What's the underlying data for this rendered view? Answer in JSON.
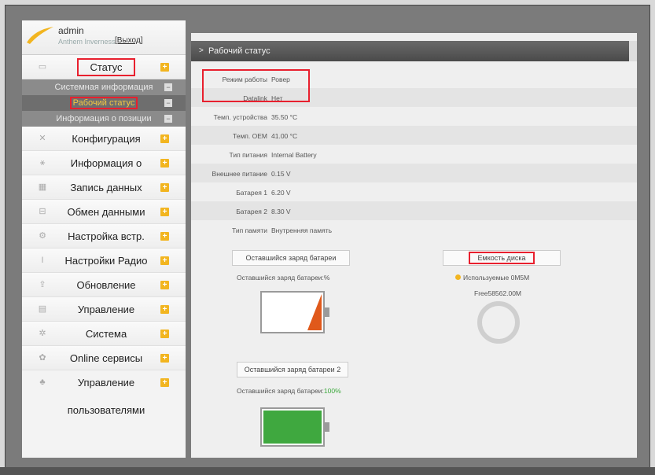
{
  "user": {
    "name": "admin",
    "subtitle": "Anthem Inverness",
    "logout": "[Выход]"
  },
  "sidebar": {
    "items": [
      {
        "label": "Статус",
        "icon": "monitor-icon"
      },
      {
        "label": "Конфигурация",
        "icon": "tools-icon"
      },
      {
        "label": "Информация о",
        "icon": "satellite-icon"
      },
      {
        "label": "Запись данных",
        "icon": "calendar-icon"
      },
      {
        "label": "Обмен данными",
        "icon": "network-icon"
      },
      {
        "label": "Настройка встр.",
        "icon": "settings-icon"
      },
      {
        "label": "Настройки Радио",
        "icon": "antenna-icon"
      },
      {
        "label": "Обновление",
        "icon": "upload-icon"
      },
      {
        "label": "Управление",
        "icon": "chip-icon"
      },
      {
        "label": "Система",
        "icon": "gear-icon"
      },
      {
        "label": "Online сервисы",
        "icon": "cloud-icon"
      },
      {
        "label": "Управление",
        "label2": "пользователями",
        "icon": "users-icon"
      }
    ],
    "submenu": [
      {
        "label": "Системная информация"
      },
      {
        "label": "Рабочий статус"
      },
      {
        "label": "Информация о позиции"
      }
    ]
  },
  "main": {
    "header": "Рабочий статус",
    "rows": [
      {
        "label": "Режим работы",
        "value": "Ровер"
      },
      {
        "label": "Datalink",
        "value": "Нет"
      },
      {
        "label": "Темп. устройства",
        "value": "35.50 °C"
      },
      {
        "label": "Темп. OEM",
        "value": "41.00 °C"
      },
      {
        "label": "Тип питания",
        "value": "Internal Battery"
      },
      {
        "label": "Внешнее питание",
        "value": "0.15 V"
      },
      {
        "label": "Батарея 1",
        "value": "6.20 V"
      },
      {
        "label": "Батарея 2",
        "value": "8.30 V"
      },
      {
        "label": "Тип памяти",
        "value": "Внутренняя память"
      }
    ],
    "battery1": {
      "title": "Оставшийся заряд батареи",
      "text": "Оставшийся заряд батареи:%",
      "level": 0.05
    },
    "battery2": {
      "title": "Оставшийся заряд батареи 2",
      "text_prefix": "Оставшийся заряд батареи:",
      "text_value": "100%",
      "level": 1.0
    },
    "disk": {
      "title": "Емкость диска",
      "used": "Используемые 0M5M",
      "free": "Free58562.00M"
    }
  },
  "colors": {
    "accent": "#f2b520",
    "highlight": "#e8202e",
    "battery_low": "#e0591b",
    "battery_full": "#3fa83f"
  }
}
